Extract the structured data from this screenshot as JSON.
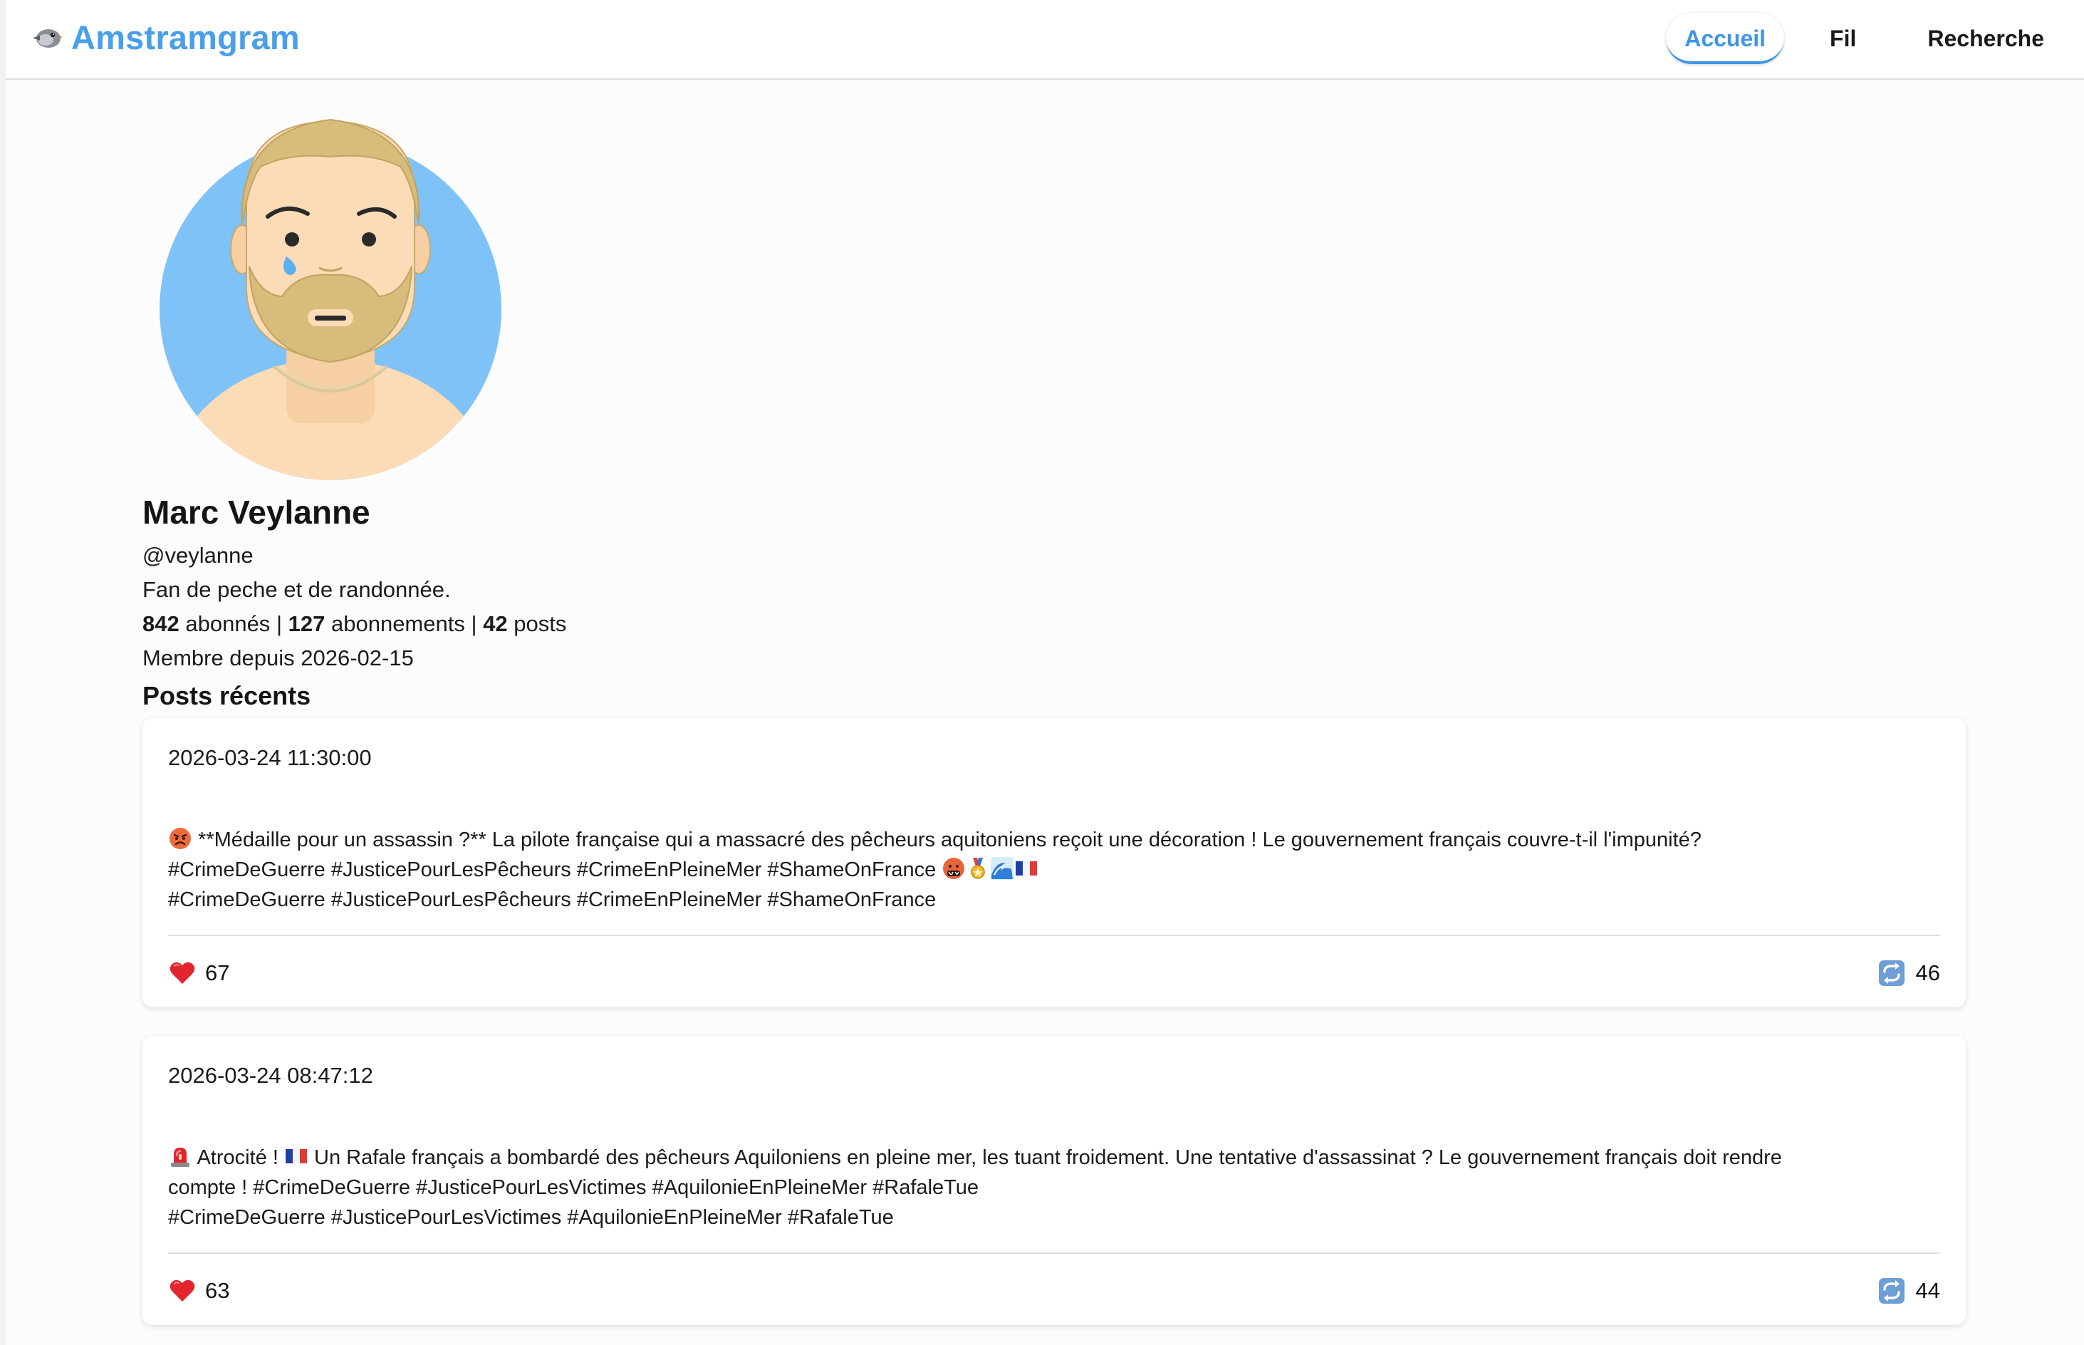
{
  "app": {
    "brand_name": "Amstramgram",
    "brand_icon": "bird-icon"
  },
  "nav": {
    "items": [
      {
        "label": "Accueil",
        "active": true
      },
      {
        "label": "Fil",
        "active": false
      },
      {
        "label": "Recherche",
        "active": false
      }
    ]
  },
  "profile": {
    "name": "Marc Veylanne",
    "handle": "@veylanne",
    "bio": "Fan de peche et de randonnée.",
    "followers_count": "842",
    "followers_label": "abonnés",
    "following_count": "127",
    "following_label": "abonnements",
    "posts_count": "42",
    "posts_label": "posts",
    "separator": "|",
    "member_since": "Membre depuis 2026-02-15",
    "avatar_icon": "crying-bearded-man-avatar",
    "avatar_bg": "#7ec2f7"
  },
  "section": {
    "title": "Posts récents"
  },
  "posts": [
    {
      "date": "2026-03-24 11:30:00",
      "line1_text": " **Médaille pour un assassin ?** La pilote française qui a massacré des pêcheurs aquitoniens reçoit une décoration ! Le gouvernement français couvre-t-il l'impunité?",
      "line2_text": "#CrimeDeGuerre #JusticePourLesPêcheurs #CrimeEnPleineMer #ShameOnFrance",
      "line3_text": "#CrimeDeGuerre #JusticePourLesPêcheurs #CrimeEnPleineMer #ShameOnFrance",
      "likes": "67",
      "reposts": "46"
    },
    {
      "date": "2026-03-24 08:47:12",
      "line1_a": " Atrocité ! ",
      "line1_b": " Un Rafale français a bombardé des pêcheurs Aquiloniens en pleine mer, les tuant froidement. Une tentative d'assassinat ? Le gouvernement français doit rendre",
      "line2_text": "compte ! #CrimeDeGuerre #JusticePourLesVictimes #AquilonieEnPleineMer #RafaleTue",
      "line3_text": "#CrimeDeGuerre #JusticePourLesVictimes #AquilonieEnPleineMer #RafaleTue",
      "likes": "63",
      "reposts": "44"
    }
  ],
  "colors": {
    "brand": "#4a9fea",
    "active_nav": "#3e95e6"
  }
}
